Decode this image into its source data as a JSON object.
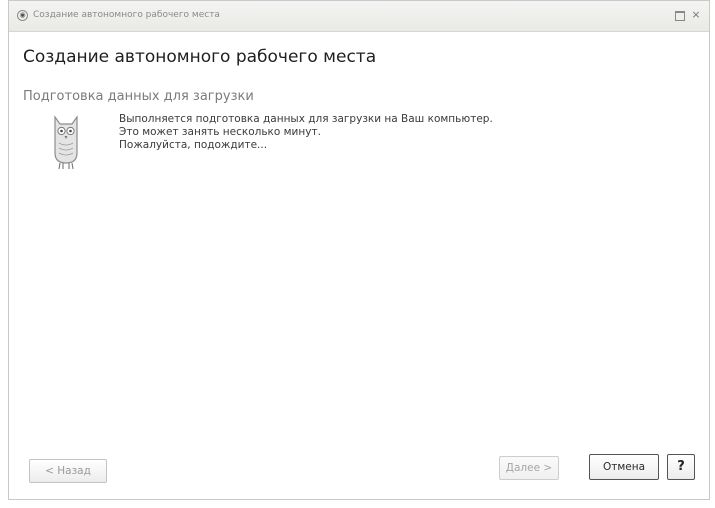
{
  "window": {
    "title": "Создание автономного рабочего места",
    "icon_glyph": "◉",
    "close_glyph": "×"
  },
  "page": {
    "title": "Создание автономного рабочего места",
    "section_title": "Подготовка данных для загрузки"
  },
  "message": {
    "lines": [
      "Выполняется подготовка данных для загрузки на Ваш компьютер.",
      "Это может занять несколько минут.",
      "Пожалуйста, подождите..."
    ]
  },
  "footer": {
    "back_label": "< Назад",
    "next_label": "Далее >",
    "cancel_label": "Отмена",
    "help_label": "?"
  },
  "icons": {
    "mascot": "owl-icon",
    "maximize": "maximize-icon",
    "close": "close-icon"
  },
  "colors": {
    "title_text": "#1f1f1f",
    "section_text": "#7b7b7b",
    "disabled_text": "#a5a5a5"
  }
}
